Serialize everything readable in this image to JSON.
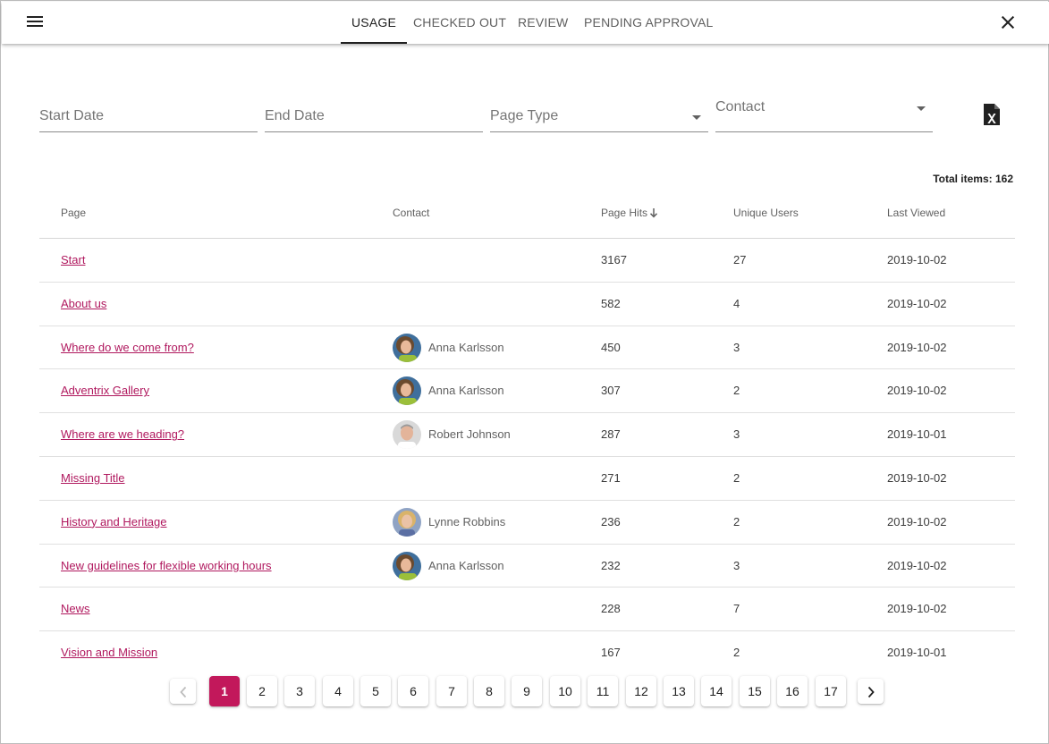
{
  "tabs": [
    "Usage",
    "Checked out",
    "Review",
    "Pending approval"
  ],
  "filters": {
    "start_date_placeholder": "Start Date",
    "end_date_placeholder": "End Date",
    "page_type_label": "Page Type",
    "contact_label": "Contact"
  },
  "total_items_text": "Total items: 162",
  "columns": [
    "Page",
    "Contact",
    "Page Hits",
    "Unique Users",
    "Last Viewed"
  ],
  "rows": [
    {
      "page": "Start",
      "contact": "",
      "hits": "3167",
      "users": "27",
      "last": "2019-10-02"
    },
    {
      "page": "About us",
      "contact": "",
      "hits": "582",
      "users": "4",
      "last": "2019-10-02"
    },
    {
      "page": "Where do we come from?",
      "contact": "Anna Karlsson",
      "hits": "450",
      "users": "3",
      "last": "2019-10-02"
    },
    {
      "page": "Adventrix Gallery",
      "contact": "Anna Karlsson",
      "hits": "307",
      "users": "2",
      "last": "2019-10-02"
    },
    {
      "page": "Where are we heading?",
      "contact": "Robert Johnson",
      "hits": "287",
      "users": "3",
      "last": "2019-10-01"
    },
    {
      "page": "Missing Title",
      "contact": "",
      "hits": "271",
      "users": "2",
      "last": "2019-10-02"
    },
    {
      "page": "History and Heritage",
      "contact": "Lynne Robbins",
      "hits": "236",
      "users": "2",
      "last": "2019-10-02"
    },
    {
      "page": "New guidelines for flexible working hours",
      "contact": "Anna Karlsson",
      "hits": "232",
      "users": "3",
      "last": "2019-10-02"
    },
    {
      "page": "News",
      "contact": "",
      "hits": "228",
      "users": "7",
      "last": "2019-10-02"
    },
    {
      "page": "Vision and Mission",
      "contact": "",
      "hits": "167",
      "users": "2",
      "last": "2019-10-01"
    }
  ],
  "pagination": {
    "pages": [
      "1",
      "2",
      "3",
      "4",
      "5",
      "6",
      "7",
      "8",
      "9",
      "10",
      "11",
      "12",
      "13",
      "14",
      "15",
      "16",
      "17"
    ],
    "current": "1"
  },
  "colors": {
    "accent": "#c2185b",
    "link": "#b0185e"
  },
  "icons": {
    "menu": "menu-icon",
    "close": "close-icon",
    "export": "excel-file-icon",
    "sort": "arrow-down-icon",
    "prev": "chevron-left-icon",
    "next": "chevron-right-icon"
  }
}
